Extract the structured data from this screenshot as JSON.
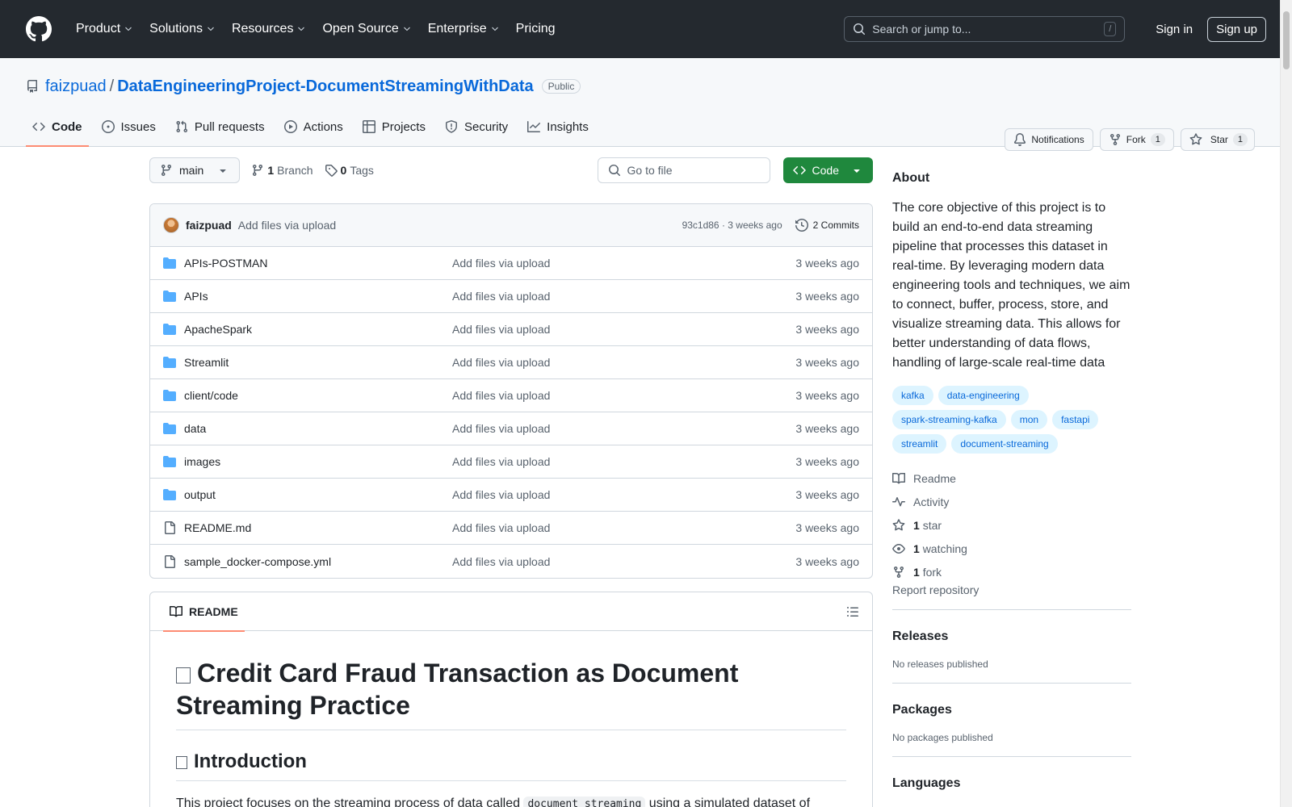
{
  "header": {
    "nav": [
      "Product",
      "Solutions",
      "Resources",
      "Open Source",
      "Enterprise",
      "Pricing"
    ],
    "search_placeholder": "Search or jump to...",
    "search_shortcut": "/",
    "sign_in": "Sign in",
    "sign_up": "Sign up"
  },
  "repo": {
    "owner": "faizpuad",
    "separator": "/",
    "name": "DataEngineeringProject-DocumentStreamingWithData",
    "visibility": "Public",
    "notifications": "Notifications",
    "fork_label": "Fork",
    "fork_count": "1",
    "star_label": "Star",
    "star_count": "1",
    "tabs": [
      "Code",
      "Issues",
      "Pull requests",
      "Actions",
      "Projects",
      "Security",
      "Insights"
    ]
  },
  "file_nav": {
    "branch": "main",
    "branch_count": "1",
    "branch_label": "Branch",
    "tag_count": "0",
    "tag_label": "Tags",
    "goto_placeholder": "Go to file",
    "code_button": "Code"
  },
  "commit": {
    "author": "faizpuad",
    "message": "Add files via upload",
    "meta": "93c1d86 · 3 weeks ago",
    "commits": "2 Commits"
  },
  "files": [
    {
      "name": "APIs-POSTMAN",
      "type": "folder",
      "commit": "Add files via upload",
      "date": "3 weeks ago"
    },
    {
      "name": "APIs",
      "type": "folder",
      "commit": "Add files via upload",
      "date": "3 weeks ago"
    },
    {
      "name": "ApacheSpark",
      "type": "folder",
      "commit": "Add files via upload",
      "date": "3 weeks ago"
    },
    {
      "name": "Streamlit",
      "type": "folder",
      "commit": "Add files via upload",
      "date": "3 weeks ago"
    },
    {
      "name": "client/code",
      "type": "folder",
      "commit": "Add files via upload",
      "date": "3 weeks ago"
    },
    {
      "name": "data",
      "type": "folder",
      "commit": "Add files via upload",
      "date": "3 weeks ago"
    },
    {
      "name": "images",
      "type": "folder",
      "commit": "Add files via upload",
      "date": "3 weeks ago"
    },
    {
      "name": "output",
      "type": "folder",
      "commit": "Add files via upload",
      "date": "3 weeks ago"
    },
    {
      "name": "README.md",
      "type": "file",
      "commit": "Add files via upload",
      "date": "3 weeks ago"
    },
    {
      "name": "sample_docker-compose.yml",
      "type": "file",
      "commit": "Add files via upload",
      "date": "3 weeks ago"
    }
  ],
  "readme": {
    "tab": "README",
    "h1": "Credit Card Fraud Transaction as Document Streaming Practice",
    "h2": "Introduction",
    "p_before": "This project focuses on the streaming process of data called ",
    "p_code": "document streaming",
    "p_after": " using a simulated dataset of"
  },
  "about": {
    "title": "About",
    "description": "The core objective of this project is to build an end-to-end data streaming pipeline that processes this dataset in real-time. By leveraging modern data engineering tools and techniques, we aim to connect, buffer, process, store, and visualize streaming data. This allows for better understanding of data flows, handling of large-scale real-time data",
    "topics": [
      "kafka",
      "data-engineering",
      "spark-streaming-kafka",
      "mon",
      "fastapi",
      "streamlit",
      "document-streaming"
    ],
    "readme": "Readme",
    "activity": "Activity",
    "stars_count": "1",
    "stars_label": "star",
    "watching_count": "1",
    "watching_label": "watching",
    "forks_count": "1",
    "forks_label": "fork",
    "report": "Report repository"
  },
  "releases": {
    "title": "Releases",
    "text": "No releases published"
  },
  "packages": {
    "title": "Packages",
    "text": "No packages published"
  },
  "languages": {
    "title": "Languages"
  },
  "colors": {
    "accent": "#0969da",
    "header_bg": "#24292f",
    "code_button": "#1f883d",
    "tab_underline": "#fd8c73",
    "folder": "#54aeff"
  }
}
